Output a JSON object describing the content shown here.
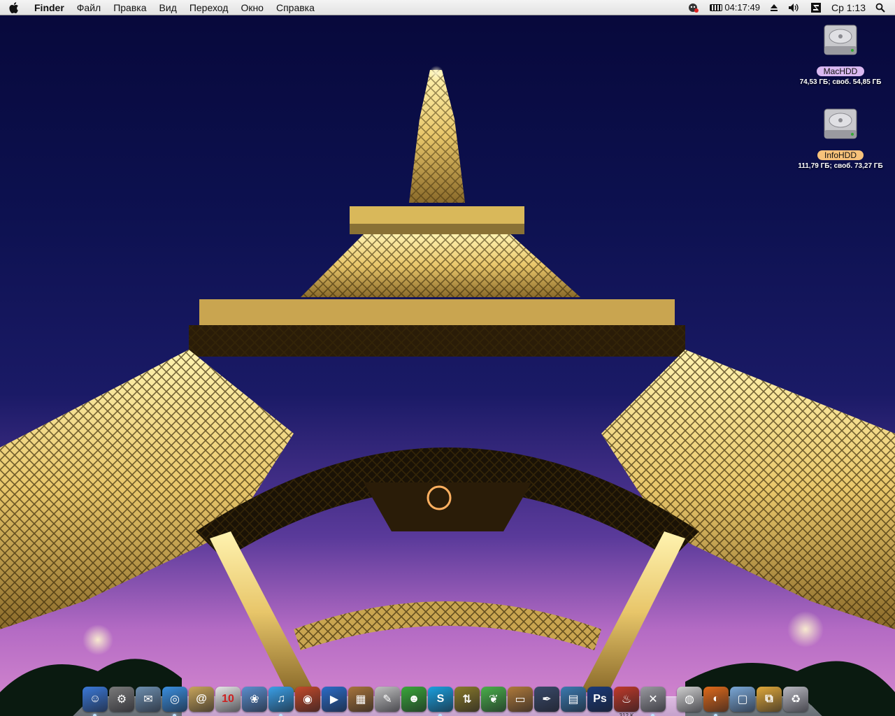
{
  "menubar": {
    "app_name": "Finder",
    "items": [
      "Файл",
      "Правка",
      "Вид",
      "Переход",
      "Окно",
      "Справка"
    ],
    "extras": {
      "battery_time": "04:17:49",
      "clock": "Ср 1:13"
    }
  },
  "desktop": {
    "disks": [
      {
        "name": "MacHDD",
        "info": "74,53 ГБ; своб. 54,85 ГБ",
        "label_color": "#d9b8f0"
      },
      {
        "name": "InfoHDD",
        "info": "111,79 ГБ; своб. 73,27 ГБ",
        "label_color": "#f7c27a"
      }
    ]
  },
  "dock": {
    "items": [
      {
        "name": "finder-icon",
        "glyph": "☺",
        "color": "#3b79d8"
      },
      {
        "name": "system-preferences-icon",
        "glyph": "⚙",
        "color": "#7a7a7a"
      },
      {
        "name": "mail-icon",
        "glyph": "✉",
        "color": "#6d8fb0"
      },
      {
        "name": "safari-icon",
        "glyph": "◎",
        "color": "#3a8fe0"
      },
      {
        "name": "address-book-icon",
        "glyph": "@",
        "color": "#c9a55a"
      },
      {
        "name": "ical-icon",
        "glyph": "10",
        "color": "#e8e8e8"
      },
      {
        "name": "iphoto-icon",
        "glyph": "❀",
        "color": "#5b8fcf"
      },
      {
        "name": "itunes-icon",
        "glyph": "♫",
        "color": "#3aa0e8"
      },
      {
        "name": "photo-booth-icon",
        "glyph": "◉",
        "color": "#c44a2a"
      },
      {
        "name": "quicktime-icon",
        "glyph": "▶",
        "color": "#2b6cc8"
      },
      {
        "name": "preview-icon",
        "glyph": "▦",
        "color": "#a8743a"
      },
      {
        "name": "script-icon",
        "glyph": "✎",
        "color": "#c0c0c0"
      },
      {
        "name": "adium-icon",
        "glyph": "☻",
        "color": "#3aa83a"
      },
      {
        "name": "skype-icon",
        "glyph": "S",
        "color": "#1aa0e0"
      },
      {
        "name": "transmit-icon",
        "glyph": "⇅",
        "color": "#8a7a2a"
      },
      {
        "name": "leaf-icon",
        "glyph": "❦",
        "color": "#4ab04a"
      },
      {
        "name": "keynote-icon",
        "glyph": "▭",
        "color": "#b07a3a"
      },
      {
        "name": "pen-tool-icon",
        "glyph": "✒",
        "color": "#3a4a6a"
      },
      {
        "name": "charts-icon",
        "glyph": "▤",
        "color": "#3a7ab0"
      },
      {
        "name": "photoshop-icon",
        "glyph": "Ps",
        "color": "#1a3a7a"
      },
      {
        "name": "activity-monitor-icon",
        "glyph": "♨",
        "color": "#c03a2a",
        "label": "312 K"
      },
      {
        "name": "utility-icon",
        "glyph": "✕",
        "color": "#9a9aa0"
      },
      {
        "name": "separator"
      },
      {
        "name": "camera-icon",
        "glyph": "◍",
        "color": "#d0d0d0"
      },
      {
        "name": "firefox-icon",
        "glyph": "◐",
        "color": "#e06a1a"
      },
      {
        "name": "applications-folder-icon",
        "glyph": "▢",
        "color": "#7aa8d8"
      },
      {
        "name": "stuff-folder-icon",
        "glyph": "⧉",
        "color": "#e0a83a"
      },
      {
        "name": "trash-icon",
        "glyph": "♻",
        "color": "#b8b8c0"
      }
    ],
    "running": [
      0,
      3,
      7,
      13,
      21,
      24
    ]
  }
}
